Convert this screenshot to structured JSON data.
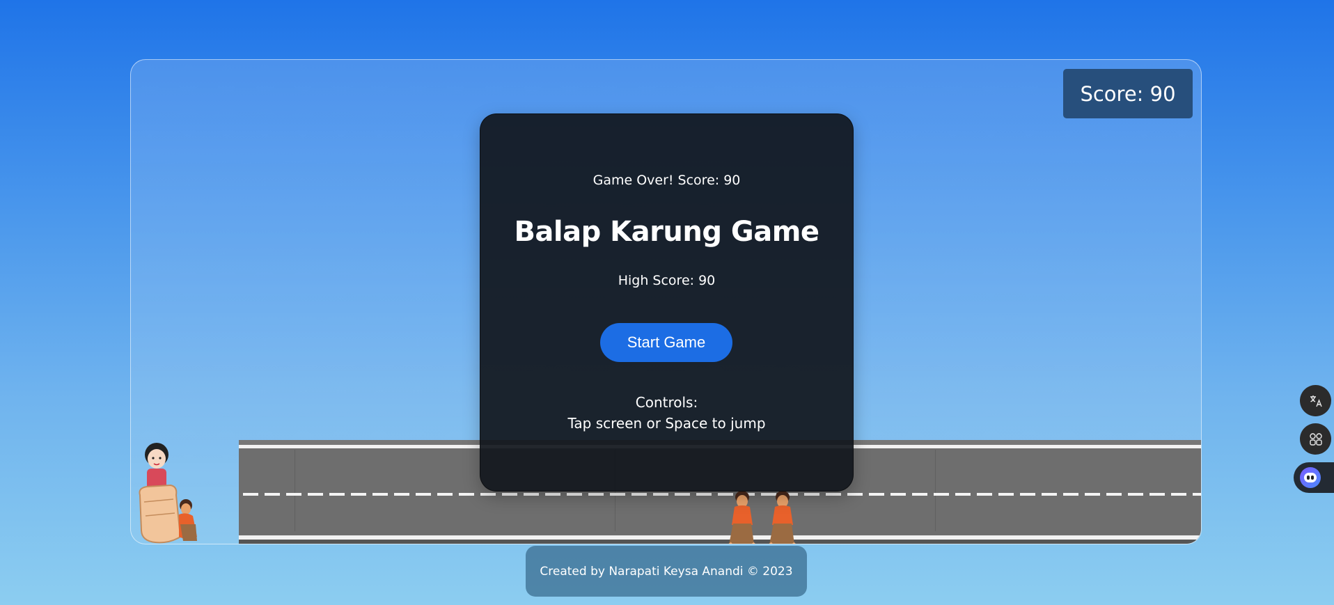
{
  "score_display": "Score: 90",
  "game_over": {
    "message": "Game Over! Score: 90",
    "title": "Balap Karung Game",
    "high_score": "High Score: 90",
    "start_button": "Start Game",
    "controls_label": "Controls:",
    "controls_text": "Tap screen or Space to jump"
  },
  "footer": {
    "credit": "Created by Narapati Keysa Anandi © 2023"
  },
  "side_tools": {
    "translate_icon": "translate-icon",
    "apps_icon": "apps-grid-icon",
    "assistant_icon": "assistant-bot-icon"
  },
  "colors": {
    "sky_top": "#1f74e8",
    "sky_bottom": "#8ccdf0",
    "score_bg": "#274f7c",
    "modal_bg": "#11161c",
    "button": "#1c6de4",
    "road": "#6e6e6e"
  }
}
